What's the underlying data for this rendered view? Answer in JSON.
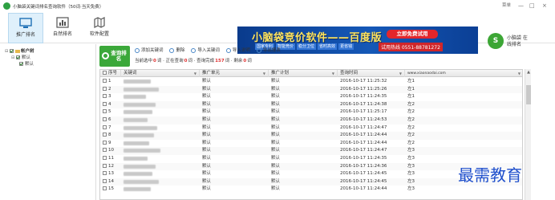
{
  "window": {
    "title": "小脑袋关键词排名查询软件（50词·当天免费）",
    "controls": [
      "菜单",
      "—",
      "□",
      "×"
    ]
  },
  "nav": [
    {
      "label": "推广排名",
      "icon": "monitor-icon",
      "active": true
    },
    {
      "label": "自然排名",
      "icon": "bar-chart-icon",
      "active": false
    },
    {
      "label": "软件配置",
      "icon": "config-icon",
      "active": false
    }
  ],
  "banner": {
    "title": "小脑袋竞价软件——百度版",
    "tags": [
      "国家专利",
      "智能竞价",
      "稳分卫位",
      "省时高效",
      "更省钱"
    ],
    "cta": "立即免费试用",
    "phone": "试用热线 0551-88781272"
  },
  "logo": {
    "text": "小脑袋 在线排名",
    "mark": "S"
  },
  "tree": {
    "root": "帐户树",
    "child": "默认",
    "leaf": "默认"
  },
  "query_button": {
    "label": "查询排名"
  },
  "toolbar": {
    "items": [
      "添加关键词",
      "删除",
      "导入关键词",
      "导入说明",
      "导出报表"
    ]
  },
  "status": {
    "prefix": "当前选中",
    "selected": "0",
    "mid1": "词 · 正在查询",
    "querying": "0",
    "mid2": "词 · 查询完成",
    "done": "157",
    "mid3": "词 · 剩余",
    "remaining": "0",
    "suffix": "词"
  },
  "table": {
    "columns": [
      "序号",
      "关键词",
      "推广单元",
      "推广计划",
      "查询时间",
      "www.xiaonaodai.com"
    ],
    "rows": [
      {
        "idx": "1",
        "unit": "默认",
        "plan": "默认",
        "time": "2016-10-17 11:25:32",
        "rank": "左1"
      },
      {
        "idx": "2",
        "unit": "默认",
        "plan": "默认",
        "time": "2016-10-17 11:25:26",
        "rank": "左1"
      },
      {
        "idx": "3",
        "unit": "默认",
        "plan": "默认",
        "time": "2016-10-17 11:24:35",
        "rank": "左1"
      },
      {
        "idx": "4",
        "unit": "默认",
        "plan": "默认",
        "time": "2016-10-17 11:24:38",
        "rank": "左2"
      },
      {
        "idx": "5",
        "unit": "默认",
        "plan": "默认",
        "time": "2016-10-17 11:25:17",
        "rank": "左2"
      },
      {
        "idx": "6",
        "unit": "默认",
        "plan": "默认",
        "time": "2016-10-17 11:24:53",
        "rank": "左2"
      },
      {
        "idx": "7",
        "unit": "默认",
        "plan": "默认",
        "time": "2016-10-17 11:24:47",
        "rank": "左2"
      },
      {
        "idx": "8",
        "unit": "默认",
        "plan": "默认",
        "time": "2016-10-17 11:24:44",
        "rank": "左2"
      },
      {
        "idx": "9",
        "unit": "默认",
        "plan": "默认",
        "time": "2016-10-17 11:24:44",
        "rank": "左2"
      },
      {
        "idx": "10",
        "unit": "默认",
        "plan": "默认",
        "time": "2016-10-17 11:24:47",
        "rank": "左3"
      },
      {
        "idx": "11",
        "unit": "默认",
        "plan": "默认",
        "time": "2016-10-17 11:24:35",
        "rank": "左3"
      },
      {
        "idx": "12",
        "unit": "默认",
        "plan": "默认",
        "time": "2016-10-17 11:24:36",
        "rank": "左3"
      },
      {
        "idx": "13",
        "unit": "默认",
        "plan": "默认",
        "time": "2016-10-17 11:24:45",
        "rank": "左3"
      },
      {
        "idx": "14",
        "unit": "默认",
        "plan": "默认",
        "time": "2016-10-17 11:24:45",
        "rank": "左3"
      },
      {
        "idx": "15",
        "unit": "默认",
        "plan": "默认",
        "time": "2016-10-17 11:24:44",
        "rank": "左3"
      }
    ]
  },
  "watermark": "最需教育",
  "colors": {
    "accent_green": "#3ba83a",
    "banner_blue": "#1558b7",
    "alert_red": "#e03030"
  }
}
